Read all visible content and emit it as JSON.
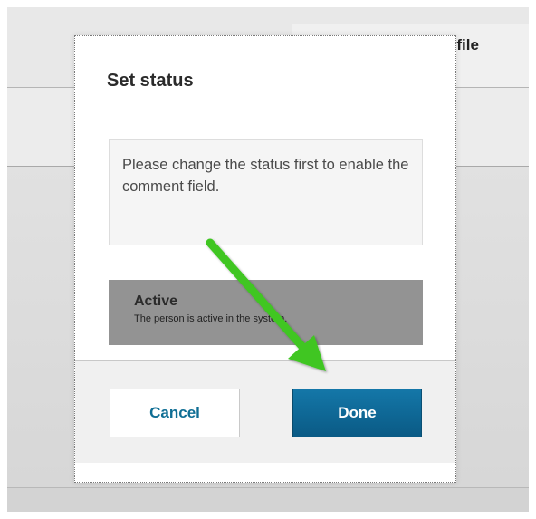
{
  "background": {
    "profile_label": "ofile"
  },
  "modal": {
    "title": "Set status",
    "comment_hint": "Please change the status first to enable the comment field.",
    "status_option": {
      "name": "Active",
      "description": "The person is active in the system."
    },
    "footer": {
      "cancel_label": "Cancel",
      "done_label": "Done"
    }
  },
  "colors": {
    "primary_button": "#0f6a98",
    "link_text": "#0f6e94",
    "status_option_bg": "#939393",
    "annotation_arrow": "#3fc624"
  },
  "annotation": {
    "icon": "arrow-icon"
  }
}
